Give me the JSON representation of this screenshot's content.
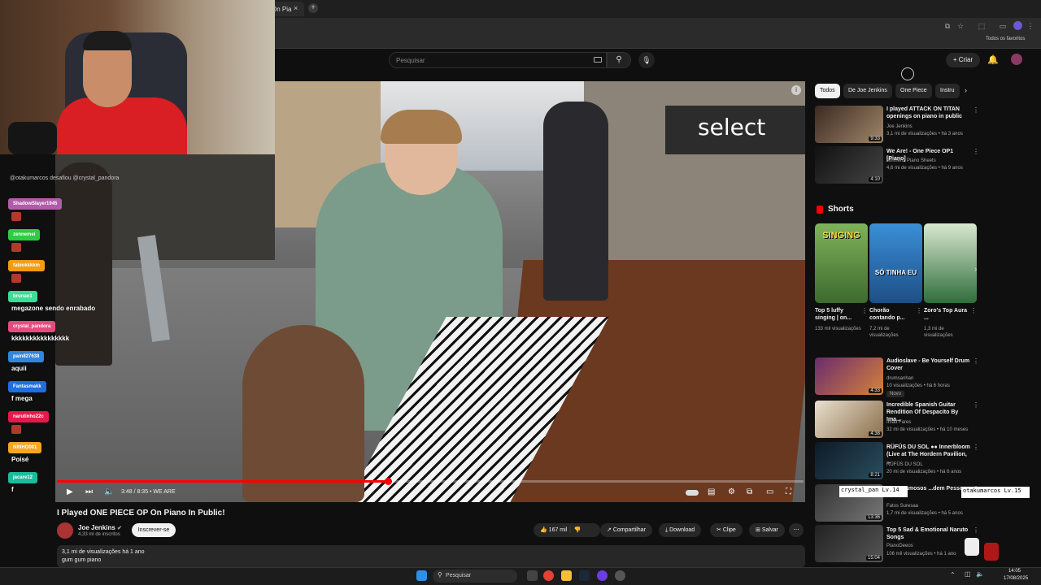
{
  "browser": {
    "tab_title": "On Pia",
    "tab_close": "×",
    "new_tab": "+",
    "bookmarks_label": "Todos os favoritos"
  },
  "youtube": {
    "search_placeholder": "Pesquisar",
    "create_label": "Criar",
    "video": {
      "title": "I Played ONE PIECE OP On Piano In Public!",
      "time": "3:48 / 8:35 • WE ARE",
      "progress": 0.443,
      "channel": "Joe Jenkins",
      "subscribers": "4,33 mi de inscritos",
      "subscribe_label": "Inscrever-se",
      "likes": "167 mil",
      "share_label": "Compartilhar",
      "download_label": "Download",
      "clip_label": "Clipe",
      "save_label": "Salvar",
      "more_label": "⋯",
      "desc_line1": "3,1 mi de visualizações  há 1 ano",
      "desc_line2": "gum gum piano"
    },
    "chips": [
      "Todos",
      "De Joe Jenkins",
      "One Piece",
      "Instru"
    ],
    "related_top": [
      {
        "title": "I played ATTACK ON TITAN openings on piano in public",
        "channel": "Joe Jenkins",
        "meta": "3,1 mi de visualizações • há 3 anos",
        "duration": "9:33"
      },
      {
        "title": "We Are! - One Piece OP1 [Piano]",
        "channel": "Animenz Piano Sheets",
        "meta": "4,6 mi de visualizações • há 9 anos",
        "duration": "4:10"
      }
    ],
    "shorts_label": "Shorts",
    "shorts": [
      {
        "title": "Top 5 luffy singing | on...",
        "meta": "133 mil visualizações",
        "thumb_text": "SINGING"
      },
      {
        "title": "Chorão contando p...",
        "meta": "7,2 mi de visualizações",
        "thumb_text": "SÓ TINHA EU"
      },
      {
        "title": "Zoro's Top Aura ...",
        "meta": "1,3 mi de visualizações",
        "thumb_text": ""
      }
    ],
    "related_bottom": [
      {
        "title": "Audioslave - Be Yourself Drum Cover",
        "channel": "drumsanhan",
        "meta": "10 visualizações • há 6 horas",
        "badge": "Novo",
        "duration": "4:33"
      },
      {
        "title": "Incredible Spanish Guitar Rendition Of Despacito By Ima...",
        "channel": "Imad Fares",
        "meta": "32 mi de visualizações • há 10 meses",
        "badge": "",
        "duration": "4:38"
      },
      {
        "title": "RÜFÜS DU SOL ●● Innerbloom (Live at The Hordern Pavilion, ...",
        "channel": "RÜFÜS DU SOL",
        "meta": "20 mi de visualizações • há 6 anos",
        "badge": "",
        "duration": "8:21"
      },
      {
        "title": "...ar - Famosos ...dem Pessoas na Rua",
        "channel": "Fatos Suresaa",
        "meta": "1,7 mi de visualizações • há 5 anos",
        "badge": "",
        "duration": "13:36"
      },
      {
        "title": "Top 5 Sad & Emotional Naruto Songs",
        "channel": "PianoDeeos",
        "meta": "106 mil visualizações • há 1 ano",
        "badge": "",
        "duration": "15:04"
      }
    ]
  },
  "chat": [
    {
      "name": "ShadowSlayer1945",
      "color": "#b05ca8",
      "message": "",
      "emote": true
    },
    {
      "name": "zennemei",
      "color": "#2ecc40",
      "message": "",
      "emote": true
    },
    {
      "name": "fabiokkkkm",
      "color": "#f39c12",
      "message": "",
      "emote": true
    },
    {
      "name": "brunao1",
      "color": "#3ddc97",
      "message": "megazone sendo enrabado",
      "emote": false
    },
    {
      "name": "crystal_pandora",
      "color": "#e84a7f",
      "message": "kkkkkkkkkkkkkkkk",
      "emote": false
    },
    {
      "name": "pain827638",
      "color": "#2e86de",
      "message": "aquii",
      "emote": false
    },
    {
      "name": "Fantasmakk",
      "color": "#1e6fe0",
      "message": "f mega",
      "emote": false
    },
    {
      "name": "narutinho22c",
      "color": "#e6194b",
      "message": "",
      "emote": true
    },
    {
      "name": "NINHO001",
      "color": "#f5a623",
      "message": "Poisé",
      "emote": false
    },
    {
      "name": "jacare12",
      "color": "#1abc9c",
      "message": "f",
      "emote": false
    }
  ],
  "overlay": {
    "tag1": "crystal_pan Lv.14",
    "tag2": "otakumarcos Lv.15",
    "webcam_banner": "@otakumarcos desafiou @crystal_pandora"
  },
  "taskbar": {
    "search": "Pesquisar",
    "time": "14:05",
    "date": "17/08/2025"
  },
  "colors": {
    "accent": "#ff0000",
    "bg": "#0f0f0f"
  }
}
